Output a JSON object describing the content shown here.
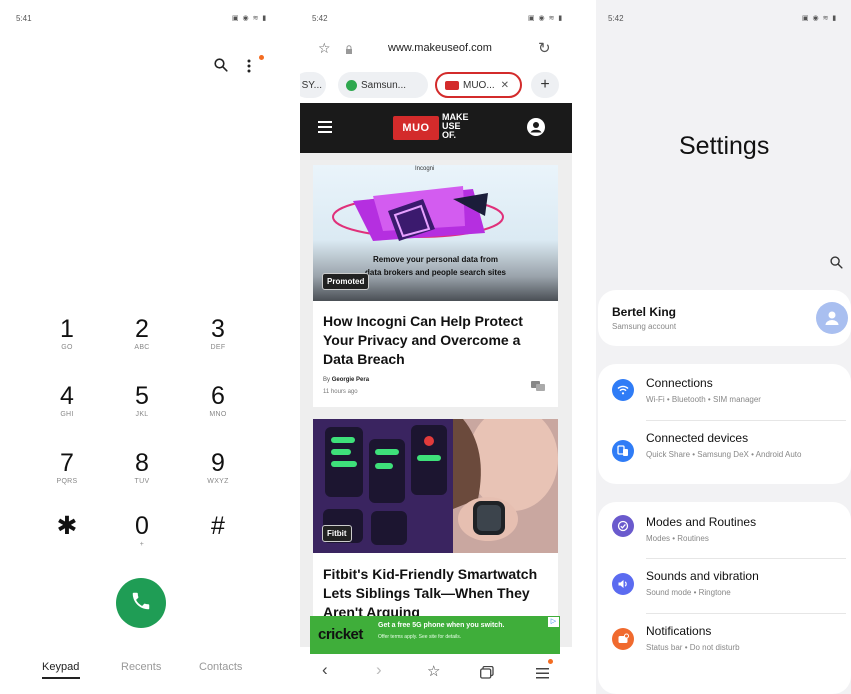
{
  "dialer": {
    "time": "5:41",
    "keys": [
      {
        "digit": "1",
        "letters": "GO"
      },
      {
        "digit": "2",
        "letters": "ABC"
      },
      {
        "digit": "3",
        "letters": "DEF"
      },
      {
        "digit": "4",
        "letters": "GHI"
      },
      {
        "digit": "5",
        "letters": "JKL"
      },
      {
        "digit": "6",
        "letters": "MNO"
      },
      {
        "digit": "7",
        "letters": "PQRS"
      },
      {
        "digit": "8",
        "letters": "TUV"
      },
      {
        "digit": "9",
        "letters": "WXYZ"
      },
      {
        "digit": "✱",
        "letters": ""
      },
      {
        "digit": "0",
        "letters": "+"
      },
      {
        "digit": "#",
        "letters": ""
      }
    ],
    "tabs": {
      "keypad": "Keypad",
      "recents": "Recents",
      "contacts": "Contacts"
    },
    "accent": "#1f9d55"
  },
  "browser": {
    "time": "5:42",
    "url": "www.makeuseof.com",
    "tabs": {
      "partial": "SY...",
      "samsung": "Samsun...",
      "muo": "MUO...",
      "close": "✕",
      "add": "+"
    },
    "logo": {
      "box": "MUO",
      "line1": "MAKE",
      "line2": "USE",
      "line3": "OF."
    },
    "card1": {
      "image_caption_top": "Incogni",
      "image_text_line1": "Remove your personal data from",
      "image_text_line2": "data brokers and people search sites",
      "badge": "Promoted",
      "title": "How Incogni Can Help Protect Your Privacy and Overcome a Data Breach",
      "byline_prefix": "By",
      "author": "Georgie Pera",
      "time_ago": "11 hours ago"
    },
    "card2": {
      "badge": "Fitbit",
      "title": "Fitbit's Kid-Friendly Smartwatch Lets Siblings Talk—When They Aren't Arguing"
    },
    "ad": {
      "brand": "cricket",
      "headline": "Get a free 5G phone when you switch.",
      "fine_print": "Offer terms apply. See site for details."
    },
    "accent": "#d32b2b"
  },
  "settings": {
    "time": "5:42",
    "title": "Settings",
    "account": {
      "name": "Bertel King",
      "sub": "Samsung account"
    },
    "items": [
      {
        "title": "Connections",
        "sub": "Wi-Fi  •  Bluetooth  •  SIM manager",
        "color": "#2f7cf6"
      },
      {
        "title": "Connected devices",
        "sub": "Quick Share  •  Samsung DeX  •  Android Auto",
        "color": "#2f7cf6"
      },
      {
        "title": "Modes and Routines",
        "sub": "Modes  •  Routines",
        "color": "#6a5acd"
      },
      {
        "title": "Sounds and vibration",
        "sub": "Sound mode  •  Ringtone",
        "color": "#5b6bf0"
      },
      {
        "title": "Notifications",
        "sub": "Status bar  •  Do not disturb",
        "color": "#f06a2e"
      }
    ]
  }
}
